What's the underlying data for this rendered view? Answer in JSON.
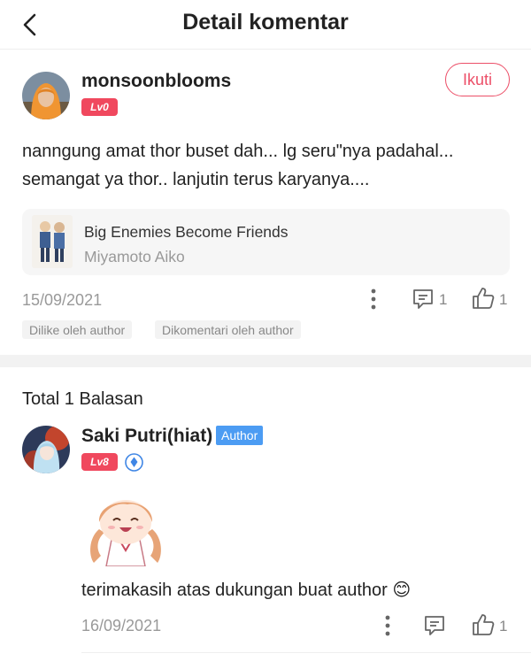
{
  "header": {
    "title": "Detail komentar",
    "back_icon": "chevron-left-icon"
  },
  "comment": {
    "username": "monsoonblooms",
    "level": "Lv0",
    "follow_label": "Ikuti",
    "text": "nanngung amat thor buset dah... lg seru\"nya padahal... semangat ya thor.. lanjutin terus karyanya....",
    "book": {
      "title": "Big Enemies Become Friends",
      "author": "Miyamoto Aiko"
    },
    "date": "15/09/2021",
    "reply_count": "1",
    "like_count": "1",
    "tags": [
      "Dilike oleh author",
      "Dikomentari oleh author"
    ]
  },
  "replies": {
    "title": "Total 1 Balasan",
    "items": [
      {
        "username": "Saki Putri(hiat)",
        "author_badge": "Author",
        "level": "Lv8",
        "text": "terimakasih atas dukungan buat author 😊",
        "date": "16/09/2021",
        "like_count": "1"
      }
    ]
  },
  "colors": {
    "accent": "#ec4f68",
    "level_badge": "#f0485e",
    "author_badge": "#4c9cf3",
    "muted": "#999999"
  }
}
